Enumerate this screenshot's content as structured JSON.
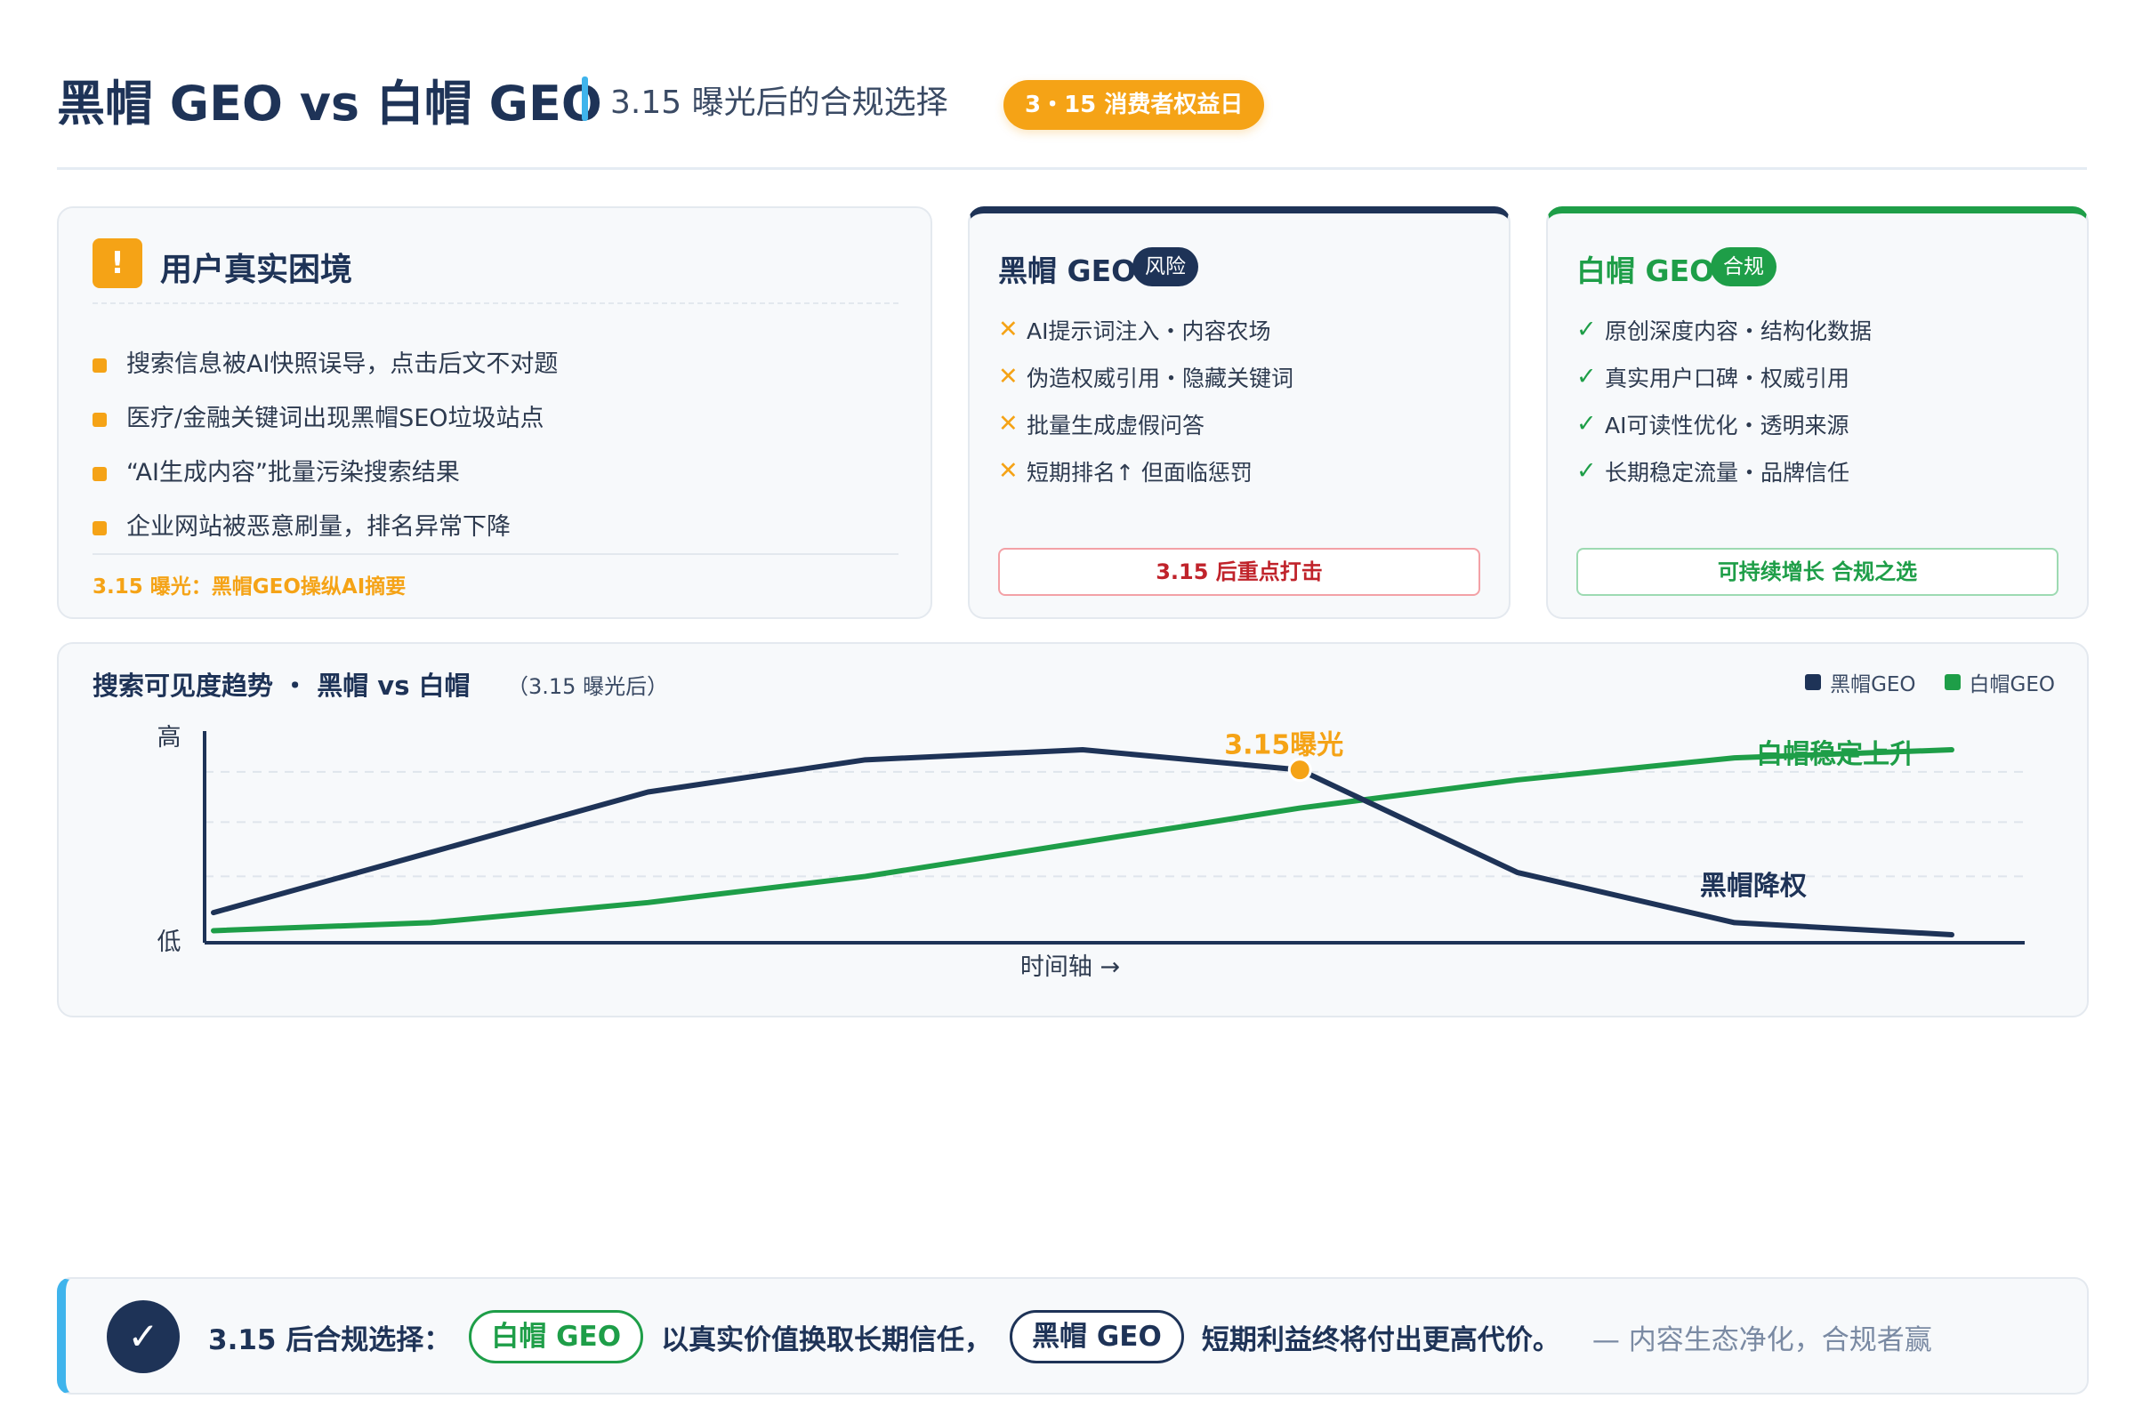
{
  "header": {
    "title": "黑帽 GEO vs 白帽 GEO",
    "subtitle": "3.15 曝光后的合规选择",
    "badge": "3・15 消费者权益日"
  },
  "pain": {
    "icon": "!",
    "title": "用户真实困境",
    "items": [
      "搜索信息被AI快照误导，点击后文不对题",
      "医疗/金融关键词出现黑帽SEO垃圾站点",
      "“AI生成内容”批量污染搜索结果",
      "企业网站被恶意刷量，排名异常下降"
    ],
    "footer": "3.15 曝光：黑帽GEO操纵AI摘要"
  },
  "black_geo": {
    "title": "黑帽 GEO",
    "tag": "风险",
    "mark": "✕",
    "items": [
      "AI提示词注入・内容农场",
      "伪造权威引用・隐藏关键词",
      "批量生成虚假问答",
      "短期排名↑ 但面临惩罚"
    ],
    "footer": "3.15 后重点打击",
    "colors": {
      "title": "#1e3357",
      "mark": "#f5a316",
      "footer": "#c0232b",
      "footer_border": "#f3a1a6"
    }
  },
  "white_geo": {
    "title": "白帽 GEO",
    "tag": "合规",
    "mark": "✓",
    "items": [
      "原创深度内容・结构化数据",
      "真实用户口碑・权威引用",
      "AI可读性优化・透明来源",
      "长期稳定流量・品牌信任"
    ],
    "footer": "可持续增长 合规之选",
    "colors": {
      "title": "#1e9e48",
      "mark": "#1e9e48",
      "footer": "#1e9e48",
      "footer_border": "#9ddab2"
    }
  },
  "chart_data": {
    "type": "line",
    "title": "搜索可见度趋势 ・ 黑帽 vs 白帽",
    "subtitle": "（3.15 曝光后）",
    "xlabel": "时间轴 →",
    "ylabel_high": "高",
    "ylabel_low": "低",
    "ylim": [
      0,
      100
    ],
    "grid": "horizontal dashed",
    "legend_position": "top-right",
    "x": [
      0,
      1,
      2,
      3,
      4,
      5,
      6,
      7,
      8
    ],
    "series": [
      {
        "name": "黑帽GEO",
        "color": "#1e3357",
        "values": [
          15,
          45,
          75,
          91,
          96,
          86,
          35,
          10,
          4
        ]
      },
      {
        "name": "白帽GEO",
        "color": "#1e9e48",
        "values": [
          6,
          10,
          20,
          33,
          50,
          67,
          81,
          92,
          96
        ]
      }
    ],
    "annotations": {
      "exposure": {
        "label": "3.15曝光",
        "color": "#f5a316",
        "x": 5,
        "y": 86
      },
      "white_end": {
        "label": "白帽稳定上升",
        "color": "#1e9e48",
        "x": 7.1,
        "y": 100
      },
      "black_end": {
        "label": "黑帽降权",
        "color": "#1e3357",
        "x": 6.8,
        "y": 24
      }
    }
  },
  "conclusion": {
    "icon": "✓",
    "lead": "3.15 后合规选择：",
    "white_pill": "白帽 GEO",
    "mid": "以真实价值换取长期信任，",
    "black_pill": "黑帽 GEO",
    "tail": "短期利益终将付出更高代价。",
    "dash_tail": "— 内容生态净化，合规者赢"
  }
}
